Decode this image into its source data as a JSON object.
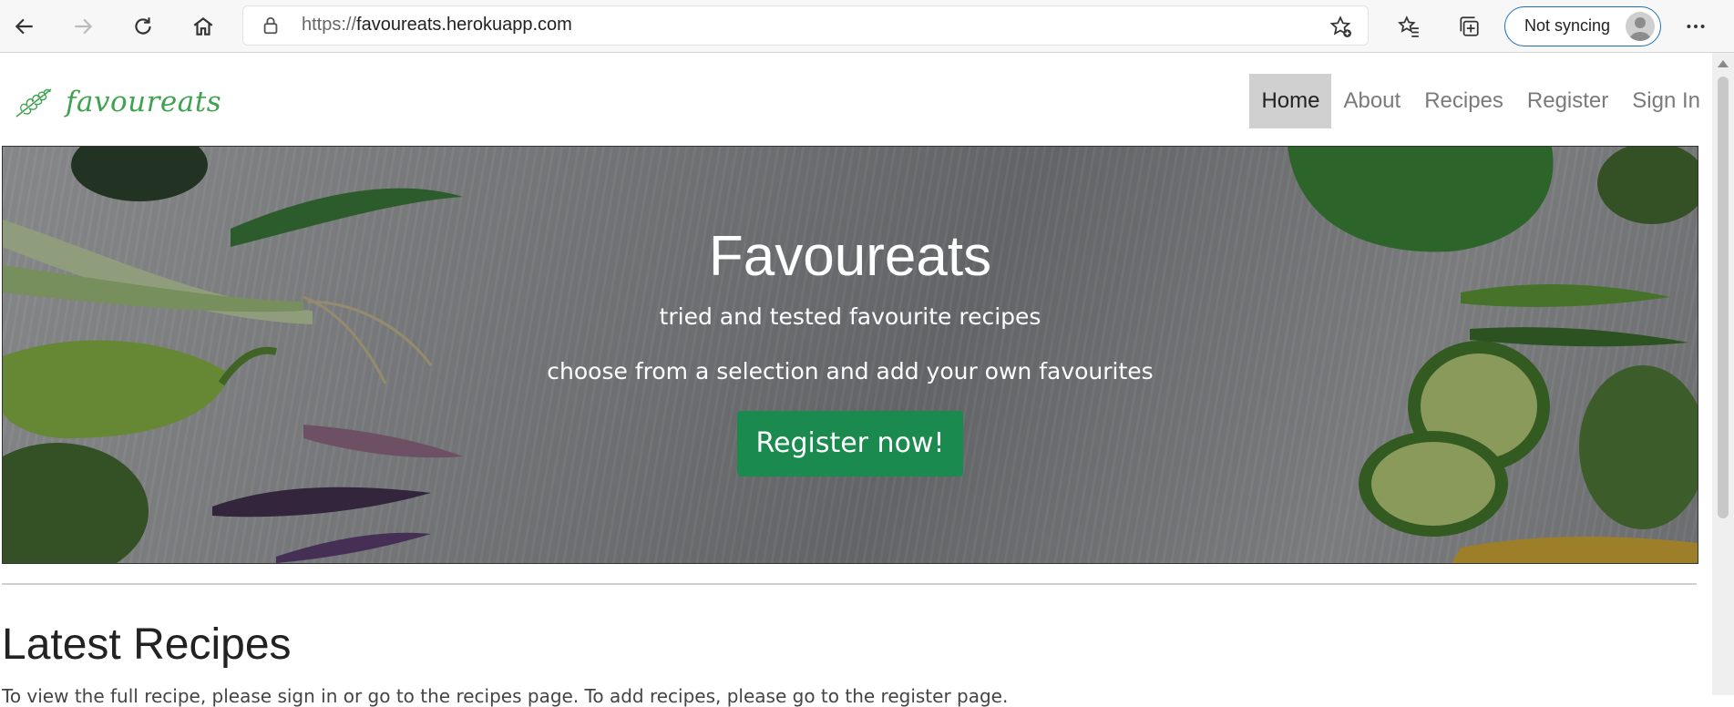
{
  "browser": {
    "url_protocol": "https://",
    "url_host": "favoureats.herokuapp.com",
    "sync_label": "Not syncing"
  },
  "site": {
    "logo_text": "favoureats",
    "nav": {
      "home": "Home",
      "about": "About",
      "recipes": "Recipes",
      "register": "Register",
      "sign_in": "Sign In"
    },
    "hero": {
      "title": "Favoureats",
      "subtitle_1": "tried and tested favourite recipes",
      "subtitle_2": "choose from a selection and add your own favourites",
      "cta": "Register now!"
    },
    "latest": {
      "title": "Latest Recipes",
      "intro": "To view the full recipe, please sign in or go to the recipes page. To add recipes, please go to the register page."
    }
  },
  "colors": {
    "brand_green": "#3fa24f",
    "cta_green": "#1b8a4e",
    "sync_border": "#1f6fb6"
  }
}
